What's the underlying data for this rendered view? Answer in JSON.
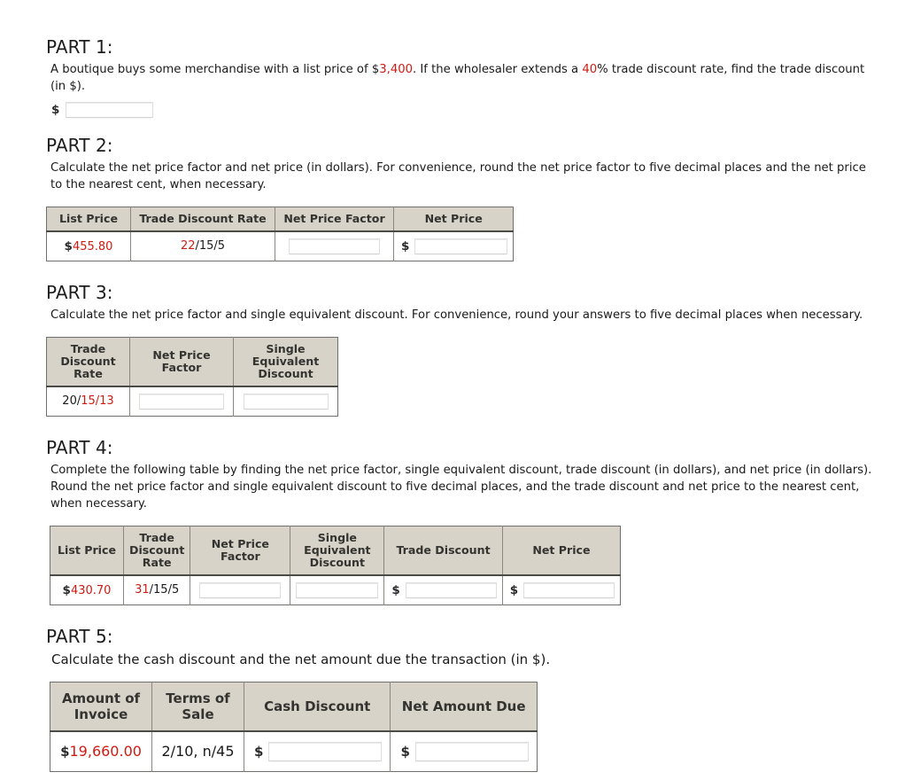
{
  "parts": {
    "p1": {
      "heading": "PART 1:",
      "desc_a": "A boutique buys some merchandise with a list price of $",
      "desc_list_price": "3,400",
      "desc_b": ". If the wholesaler extends a ",
      "desc_rate": "40",
      "desc_c": "% trade discount rate, find the trade discount (in $).",
      "dollar": "$",
      "answer_value": ""
    },
    "p2": {
      "heading": "PART 2:",
      "desc": "Calculate the net price factor and net price (in dollars). For convenience, round the net price factor to five decimal places and the net price to the nearest cent, when necessary.",
      "headers": [
        "List Price",
        "Trade Discount Rate",
        "Net Price Factor",
        "Net Price"
      ],
      "row": {
        "list_price_symbol": "$",
        "list_price": "455.80",
        "rate_red": "22",
        "rate_rest": "/15/5",
        "net_price_factor_value": "",
        "net_price_symbol": "$",
        "net_price_value": ""
      }
    },
    "p3": {
      "heading": "PART 3:",
      "desc": "Calculate the net price factor and single equivalent discount. For convenience, round your answers to five decimal places when necessary.",
      "headers": [
        "Trade Discount Rate",
        "Net Price Factor",
        "Single Equivalent Discount"
      ],
      "row": {
        "rate_black": "20/",
        "rate_red": "15/13",
        "net_price_factor_value": "",
        "single_equivalent_discount_value": ""
      }
    },
    "p4": {
      "heading": "PART 4:",
      "desc": "Complete the following table by finding the net price factor, single equivalent discount, trade discount (in dollars), and net price (in dollars). Round the net price factor and single equivalent discount to five decimal places, and the trade discount and net price to the nearest cent, when necessary.",
      "headers": [
        "List Price",
        "Trade Discount Rate",
        "Net Price Factor",
        "Single Equivalent Discount",
        "Trade Discount",
        "Net Price"
      ],
      "row": {
        "list_price_symbol": "$",
        "list_price": "430.70",
        "rate_red": "31",
        "rate_rest": "/15/5",
        "net_price_factor_value": "",
        "single_equivalent_discount_value": "",
        "trade_discount_symbol": "$",
        "trade_discount_value": "",
        "net_price_symbol": "$",
        "net_price_value": ""
      }
    },
    "p5": {
      "heading": "PART 5:",
      "desc": "Calculate the cash discount and the net amount due the transaction (in $).",
      "headers": [
        "Amount of Invoice",
        "Terms of Sale",
        "Cash Discount",
        "Net Amount Due"
      ],
      "row": {
        "amount_symbol": "$",
        "amount": "19,660.00",
        "terms": "2/10, n/45",
        "cash_discount_symbol": "$",
        "cash_discount_value": "",
        "net_amount_due_symbol": "$",
        "net_amount_due_value": ""
      }
    }
  },
  "colors": {
    "red_highlight": "#d01b12",
    "table_header_bg": "#d8d3c9",
    "table_border": "#6f6f6b"
  }
}
